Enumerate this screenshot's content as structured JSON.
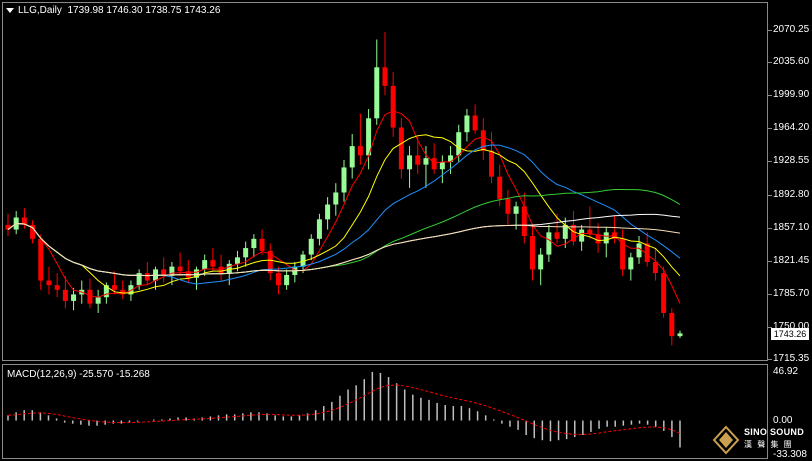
{
  "header": {
    "title": "LLG,Daily",
    "ohlc": "1739.98 1746.30 1738.75 1743.26"
  },
  "price_axis": {
    "ticks": [
      "2070.25",
      "2035.60",
      "1999.90",
      "1964.20",
      "1928.55",
      "1892.80",
      "1857.10",
      "1821.45",
      "1785.70",
      "1750.00",
      "1715.35"
    ],
    "current_price": "1743.26"
  },
  "macd": {
    "label": "MACD(12,26,9) -25.570 -15.268",
    "ticks": [
      "46.92",
      "0.00",
      "-33.308"
    ]
  },
  "logo": {
    "name": "SINO SOUND",
    "sub": "漢 聲 集 團"
  },
  "colors": {
    "bull": "#98fb98",
    "bear": "#ff0000",
    "ma_fast": "#ffff00",
    "ma_slow_blue": "#1e90ff",
    "ma_green": "#32cd32",
    "ma_white": "#ffffff",
    "ma_tan": "#f5deb3",
    "macd_bar": "#c0c0c0",
    "signal": "#ff0000"
  },
  "chart_data": {
    "type": "candlestick",
    "symbol": "LLG",
    "timeframe": "Daily",
    "ylim": [
      1715.35,
      2070.25
    ],
    "candles": [
      [
        1860,
        1872,
        1848,
        1855
      ],
      [
        1855,
        1875,
        1850,
        1868
      ],
      [
        1868,
        1878,
        1856,
        1860
      ],
      [
        1860,
        1865,
        1840,
        1845
      ],
      [
        1845,
        1850,
        1790,
        1800
      ],
      [
        1800,
        1815,
        1785,
        1795
      ],
      [
        1795,
        1808,
        1782,
        1790
      ],
      [
        1790,
        1805,
        1770,
        1778
      ],
      [
        1778,
        1792,
        1768,
        1785
      ],
      [
        1785,
        1800,
        1775,
        1790
      ],
      [
        1790,
        1802,
        1770,
        1775
      ],
      [
        1775,
        1790,
        1765,
        1782
      ],
      [
        1782,
        1798,
        1775,
        1795
      ],
      [
        1795,
        1810,
        1785,
        1790
      ],
      [
        1790,
        1800,
        1780,
        1785
      ],
      [
        1785,
        1800,
        1778,
        1795
      ],
      [
        1795,
        1812,
        1790,
        1808
      ],
      [
        1808,
        1820,
        1795,
        1800
      ],
      [
        1800,
        1815,
        1790,
        1812
      ],
      [
        1812,
        1825,
        1798,
        1805
      ],
      [
        1805,
        1820,
        1795,
        1815
      ],
      [
        1815,
        1830,
        1805,
        1810
      ],
      [
        1810,
        1822,
        1798,
        1803
      ],
      [
        1803,
        1815,
        1790,
        1812
      ],
      [
        1812,
        1828,
        1805,
        1822
      ],
      [
        1822,
        1835,
        1810,
        1815
      ],
      [
        1815,
        1828,
        1800,
        1808
      ],
      [
        1808,
        1822,
        1795,
        1818
      ],
      [
        1818,
        1832,
        1810,
        1825
      ],
      [
        1825,
        1842,
        1815,
        1835
      ],
      [
        1835,
        1850,
        1825,
        1845
      ],
      [
        1845,
        1855,
        1828,
        1832
      ],
      [
        1832,
        1840,
        1800,
        1808
      ],
      [
        1808,
        1815,
        1785,
        1795
      ],
      [
        1795,
        1812,
        1790,
        1806
      ],
      [
        1806,
        1820,
        1798,
        1815
      ],
      [
        1815,
        1832,
        1808,
        1828
      ],
      [
        1828,
        1850,
        1822,
        1845
      ],
      [
        1845,
        1872,
        1838,
        1866
      ],
      [
        1866,
        1890,
        1855,
        1882
      ],
      [
        1882,
        1905,
        1870,
        1895
      ],
      [
        1895,
        1930,
        1885,
        1922
      ],
      [
        1922,
        1958,
        1910,
        1945
      ],
      [
        1945,
        1980,
        1925,
        1935
      ],
      [
        1935,
        1985,
        1920,
        1975
      ],
      [
        1975,
        2060,
        1968,
        2030
      ],
      [
        2030,
        2068,
        2000,
        2010
      ],
      [
        2010,
        2025,
        1955,
        1965
      ],
      [
        1965,
        1975,
        1910,
        1920
      ],
      [
        1920,
        1945,
        1900,
        1935
      ],
      [
        1935,
        1955,
        1915,
        1925
      ],
      [
        1925,
        1945,
        1900,
        1932
      ],
      [
        1932,
        1948,
        1915,
        1920
      ],
      [
        1920,
        1935,
        1905,
        1928
      ],
      [
        1928,
        1945,
        1915,
        1935
      ],
      [
        1935,
        1968,
        1928,
        1960
      ],
      [
        1960,
        1985,
        1950,
        1978
      ],
      [
        1978,
        1990,
        1958,
        1962
      ],
      [
        1962,
        1975,
        1930,
        1940
      ],
      [
        1940,
        1960,
        1905,
        1912
      ],
      [
        1912,
        1925,
        1880,
        1888
      ],
      [
        1888,
        1898,
        1860,
        1872
      ],
      [
        1872,
        1885,
        1855,
        1880
      ],
      [
        1880,
        1895,
        1840,
        1848
      ],
      [
        1848,
        1860,
        1800,
        1812
      ],
      [
        1812,
        1835,
        1795,
        1828
      ],
      [
        1828,
        1860,
        1820,
        1852
      ],
      [
        1852,
        1872,
        1840,
        1845
      ],
      [
        1845,
        1868,
        1835,
        1860
      ],
      [
        1860,
        1875,
        1838,
        1842
      ],
      [
        1842,
        1860,
        1832,
        1855
      ],
      [
        1855,
        1880,
        1845,
        1850
      ],
      [
        1850,
        1862,
        1830,
        1840
      ],
      [
        1840,
        1858,
        1825,
        1852
      ],
      [
        1852,
        1870,
        1840,
        1845
      ],
      [
        1845,
        1855,
        1805,
        1812
      ],
      [
        1812,
        1830,
        1800,
        1825
      ],
      [
        1825,
        1848,
        1818,
        1840
      ],
      [
        1840,
        1852,
        1815,
        1820
      ],
      [
        1820,
        1835,
        1800,
        1808
      ],
      [
        1808,
        1815,
        1760,
        1765
      ],
      [
        1765,
        1770,
        1730,
        1740
      ],
      [
        1740,
        1746,
        1738,
        1743
      ]
    ],
    "macd_values": [
      5,
      8,
      10,
      10,
      8,
      5,
      2,
      -2,
      -3,
      -4,
      -5,
      -5,
      -4,
      -3,
      -3,
      -2,
      -1,
      0,
      1,
      1,
      2,
      3,
      3,
      2,
      3,
      4,
      5,
      6,
      6,
      7,
      8,
      8,
      7,
      5,
      4,
      4,
      5,
      7,
      10,
      14,
      18,
      24,
      30,
      34,
      40,
      47,
      46,
      42,
      36,
      30,
      25,
      22,
      20,
      17,
      15,
      14,
      14,
      12,
      9,
      5,
      1,
      -3,
      -6,
      -9,
      -14,
      -17,
      -19,
      -20,
      -19,
      -18,
      -16,
      -14,
      -11,
      -8,
      -6,
      -6,
      -5,
      -4,
      -3,
      -4,
      -6,
      -10,
      -16,
      -26
    ]
  }
}
